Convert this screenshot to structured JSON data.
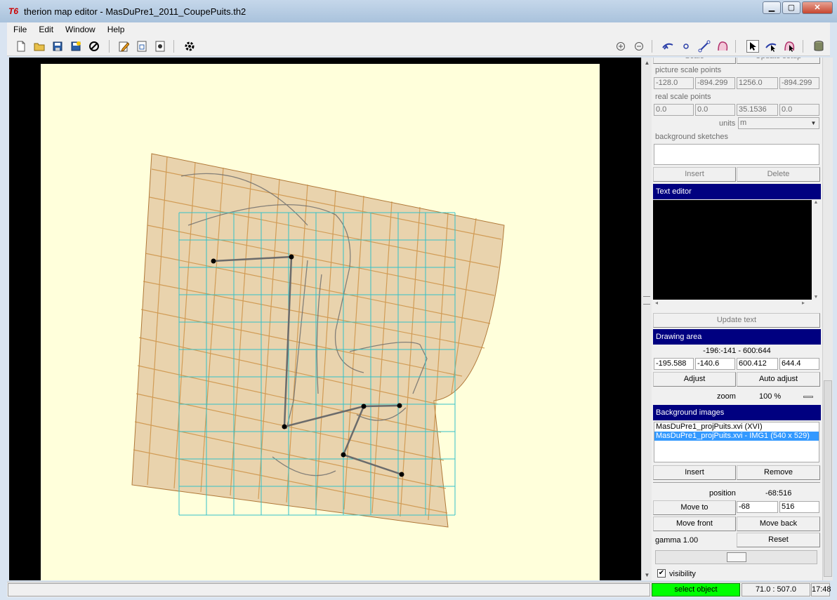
{
  "window": {
    "title": "therion map editor - MasDuPre1_2011_CoupePuits.th2",
    "logo_text": "T6",
    "minimize": "▁",
    "maximize": "▢",
    "close": "✕"
  },
  "menu": [
    "File",
    "Edit",
    "Window",
    "Help"
  ],
  "toolbar": {
    "icons_left": [
      "new-file-icon",
      "open-folder-icon",
      "save-icon",
      "save-as-icon",
      "close-file-icon",
      "edit-text-icon",
      "area-icon",
      "settings-file-icon",
      "compile-gear-icon"
    ],
    "icons_right": [
      "zoom-in-icon",
      "zoom-out-icon",
      "insert-point-icon",
      "point-icon",
      "line-icon",
      "area-shape-icon",
      "select-arrow-icon",
      "select-line-icon",
      "select-area-icon",
      "database-icon"
    ]
  },
  "panel": {
    "top_buttons": [
      "Scale",
      "Update setup"
    ],
    "picture_scale_points_label": "picture scale points",
    "picture_scale_points": [
      "-128.0",
      "-894.299",
      "1256.0",
      "-894.299"
    ],
    "real_scale_points_label": "real scale points",
    "real_scale_points": [
      "0.0",
      "0.0",
      "35.1536",
      "0.0"
    ],
    "units_label": "units",
    "units_value": "m",
    "background_sketches_label": "background sketches",
    "sketch_buttons": [
      "Insert",
      "Delete"
    ],
    "text_editor_header": "Text editor",
    "update_text_button": "Update text",
    "drawing_area_header": "Drawing area",
    "drawing_area_range": "-196:-141 - 600:644",
    "drawing_area_values": [
      "-195.588",
      "-140.6",
      "600.412",
      "644.4"
    ],
    "adjust_button": "Adjust",
    "auto_adjust_button": "Auto adjust",
    "zoom_label": "zoom",
    "zoom_value": "100 %",
    "background_images_header": "Background images",
    "background_images": [
      "MasDuPre1_projPuits.xvi (XVI)",
      "MasDuPre1_projPuits.xvi - IMG1 (540 x 529)"
    ],
    "selected_image_index": 1,
    "insert_button": "Insert",
    "remove_button": "Remove",
    "position_label": "position",
    "position_value": "-68:516",
    "move_to_button": "Move to",
    "move_to_x": "-68",
    "move_to_y": "516",
    "move_front_button": "Move front",
    "move_back_button": "Move back",
    "gamma_label": "gamma 1.00",
    "reset_button": "Reset",
    "gamma_level": 0.5,
    "visibility_label": "visibility",
    "visibility_checked": true
  },
  "status": {
    "mode": "select object",
    "coordinates": "71.0 : 507.0",
    "time": "17:48"
  }
}
